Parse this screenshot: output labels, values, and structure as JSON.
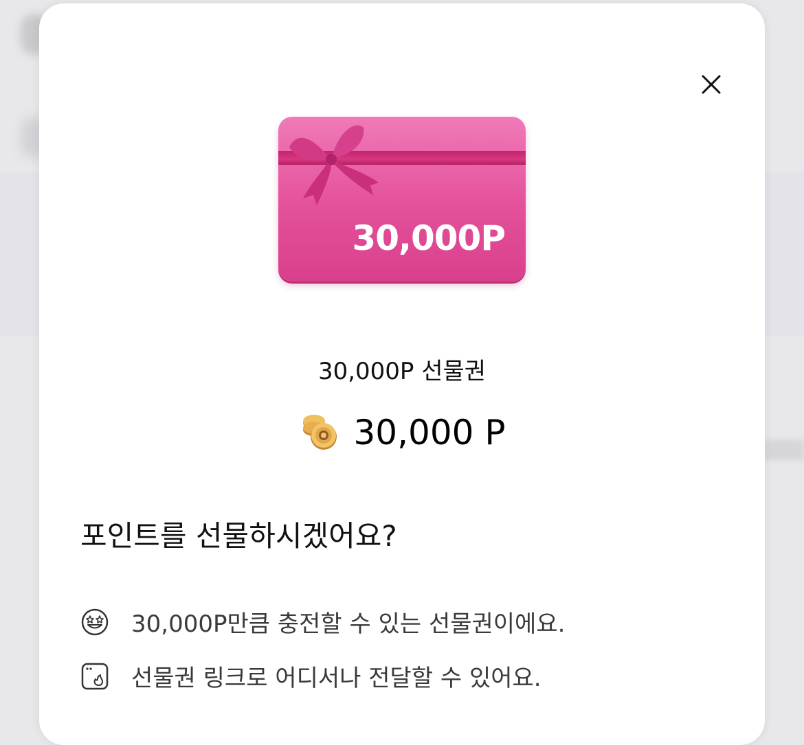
{
  "dialog": {
    "close_icon": "close-icon",
    "card_label": "30,000P",
    "product_name": "30,000P 선물권",
    "price": "30,000 P",
    "price_icon": "coin-stack-icon",
    "question": "포인트를 선물하시겠어요?",
    "info": [
      {
        "icon": "star-eyes-smile-icon",
        "text": "30,000P만큼 충전할 수 있는 선물권이에요."
      },
      {
        "icon": "browser-fire-icon",
        "text": "선물권 링크로 어디서나 전달할 수 있어요."
      }
    ]
  },
  "colors": {
    "card_pink": "#e4509a",
    "ribbon": "#c2246f",
    "coin_gold": "#e0a84a"
  }
}
